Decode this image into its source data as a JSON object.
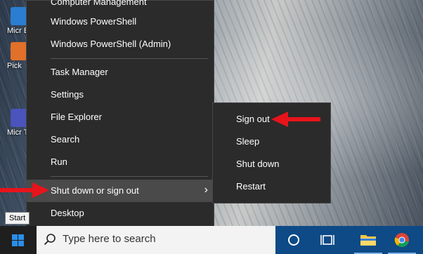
{
  "desktop": {
    "icons": [
      {
        "name": "edge-shortcut",
        "label": "Micr Ed"
      },
      {
        "name": "pick-app-shortcut",
        "label": "Pick"
      },
      {
        "name": "teams-shortcut",
        "label": "Micr Tea"
      }
    ]
  },
  "context_menu": {
    "items": [
      {
        "label": "Computer Management"
      },
      {
        "label": "Windows PowerShell"
      },
      {
        "label": "Windows PowerShell (Admin)"
      },
      {
        "label": "Task Manager"
      },
      {
        "label": "Settings"
      },
      {
        "label": "File Explorer"
      },
      {
        "label": "Search"
      },
      {
        "label": "Run"
      },
      {
        "label": "Shut down or sign out"
      },
      {
        "label": "Desktop"
      }
    ],
    "chevron": "›"
  },
  "submenu": {
    "items": [
      {
        "label": "Sign out"
      },
      {
        "label": "Sleep"
      },
      {
        "label": "Shut down"
      },
      {
        "label": "Restart"
      }
    ]
  },
  "taskbar": {
    "start_tooltip": "Start",
    "search_placeholder": "Type here to search",
    "icons": [
      "cortana-icon",
      "task-view-icon",
      "file-explorer-icon",
      "chrome-icon"
    ]
  },
  "colors": {
    "menu_bg": "#2b2b2b",
    "highlight": "#4a4a4a",
    "taskbar_blue": "#0d4a86",
    "annotation_red": "#e8141b"
  }
}
